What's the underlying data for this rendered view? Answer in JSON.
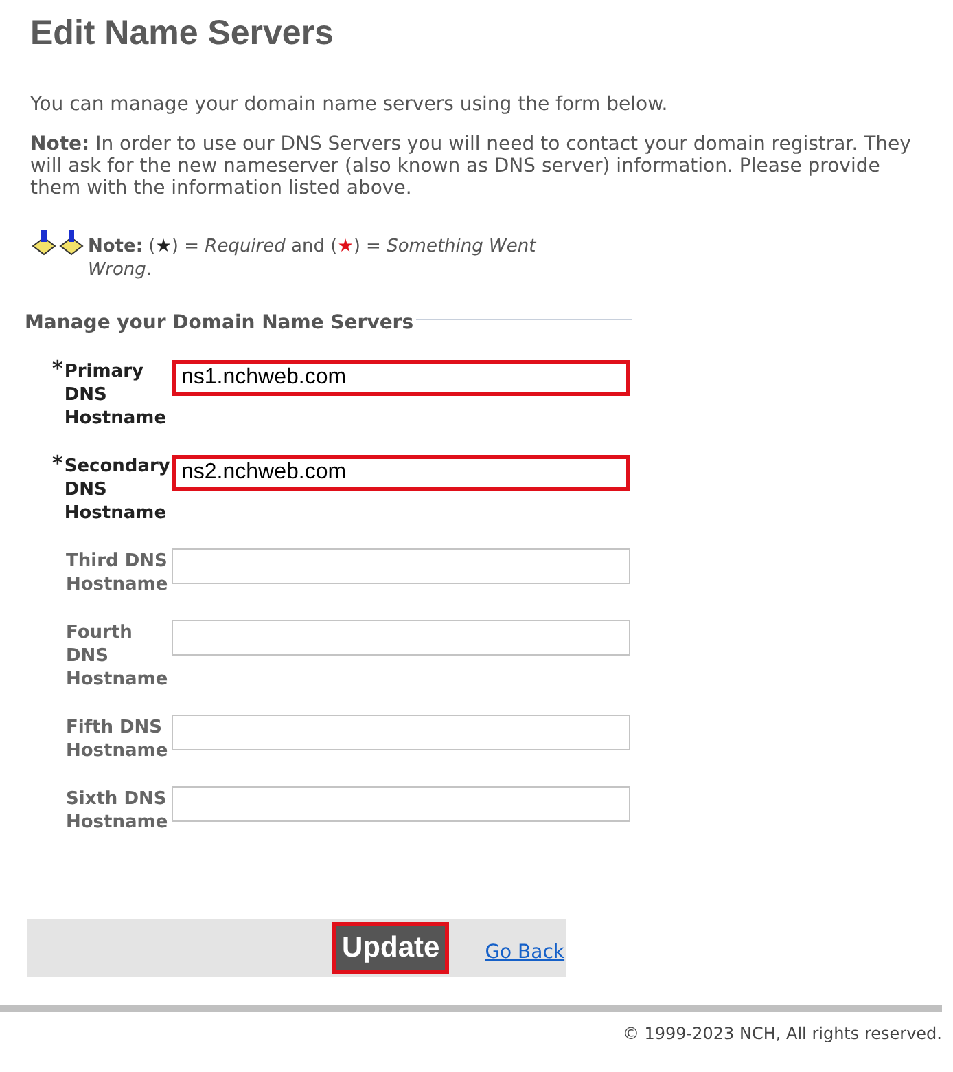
{
  "title": "Edit Name Servers",
  "intro": "You can manage your domain name servers using the form below.",
  "note": "**Note:** In order to use our DNS Servers you will need to contact your domain registrar. They will ask for the new nameserver (also known as DNS server) information. Please provide them with the information listed above.",
  "legend_note": [
    {
      "kind": "text",
      "text": "**Note:** ("
    },
    {
      "kind": "star",
      "text": "★",
      "color": "#222222"
    },
    {
      "kind": "text",
      "text": ") = *Required* and ("
    },
    {
      "kind": "star",
      "text": "★",
      "color": "#e0101a"
    },
    {
      "kind": "text",
      "text": ") = *Something Went Wrong*."
    }
  ],
  "section_title": "Manage your Domain Name Servers",
  "fields": [
    {
      "marker": "*",
      "label": "Primary DNS Hostname",
      "value": "ns1.nchweb.com",
      "required": true,
      "error": true
    },
    {
      "marker": "*",
      "label": "Secondary DNS Hostname",
      "value": "ns2.nchweb.com",
      "required": true,
      "error": true
    },
    {
      "label": "Third DNS Hostname",
      "required": false,
      "error": false
    },
    {
      "label": "Fourth DNS Hostname",
      "required": false,
      "error": false
    },
    {
      "label": "Fifth DNS Hostname",
      "required": false,
      "error": false
    },
    {
      "label": "Sixth DNS Hostname",
      "required": false,
      "error": false
    }
  ],
  "update_button": "Update",
  "back_link": "Go Back",
  "copyright": "© 1999-2023 NCH, All rights reserved."
}
